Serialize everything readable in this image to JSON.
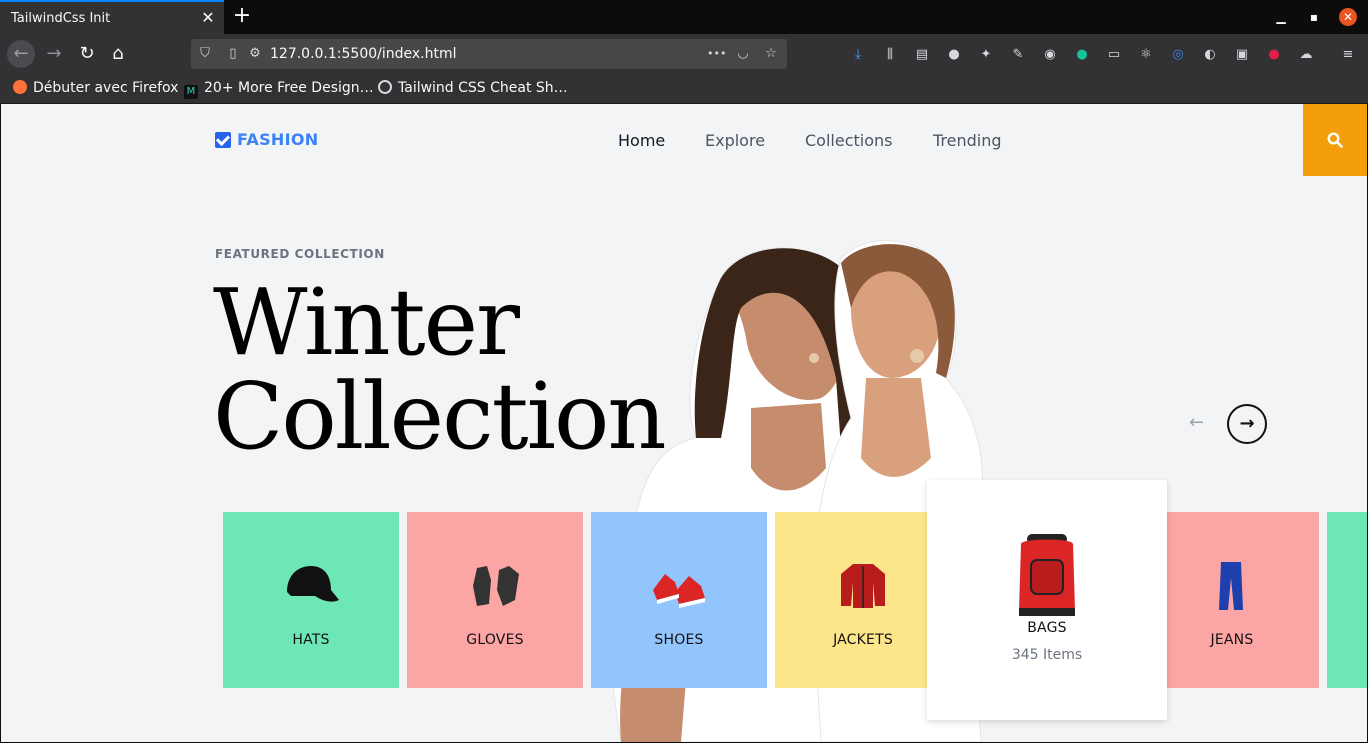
{
  "browser": {
    "tab_title": "TailwindCss Init",
    "url": "127.0.0.1:5500/index.html",
    "url_more": "•••",
    "bookmarks": [
      {
        "label": "Débuter avec Firefox"
      },
      {
        "label": "20+ More Free Design…"
      },
      {
        "label": "Tailwind CSS Cheat Sh…"
      }
    ]
  },
  "site": {
    "logo": "FASHION",
    "menu": [
      "Home",
      "Explore",
      "Collections",
      "Trending"
    ],
    "eyebrow": "FEATURED COLLECTION",
    "headline": "Winter\nCollection",
    "arrow_prev": "←",
    "arrow_next": "→",
    "categories": [
      {
        "label": "HATS",
        "color": "#6ee7b7"
      },
      {
        "label": "GLOVES",
        "color": "#fca5a5"
      },
      {
        "label": "SHOES",
        "color": "#93c5fd"
      },
      {
        "label": "JACKETS",
        "color": "#fde68a"
      },
      {
        "label": "BAGS",
        "count": "345 Items",
        "color": "#ffffff"
      },
      {
        "label": "JEANS",
        "color": "#fca5a5"
      }
    ],
    "accent": "#f59e0b",
    "brand": "#3b82f6"
  }
}
